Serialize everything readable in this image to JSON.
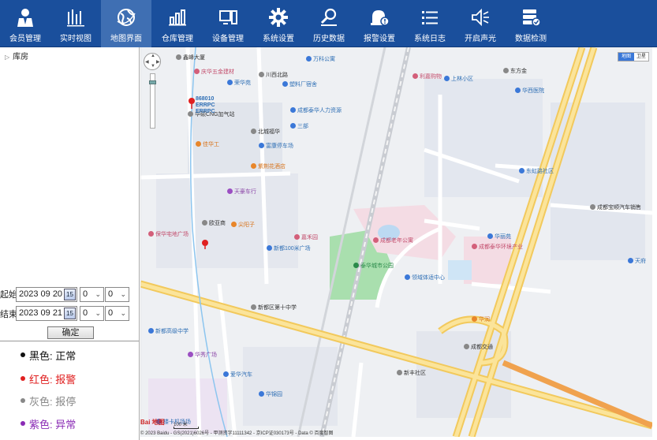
{
  "nav": {
    "items": [
      {
        "label": "会员管理",
        "icon": "member-icon"
      },
      {
        "label": "实时视图",
        "icon": "realtime-chart-icon"
      },
      {
        "label": "地图界面",
        "icon": "map-globe-icon"
      },
      {
        "label": "仓库管理",
        "icon": "warehouse-chart-icon"
      },
      {
        "label": "设备管理",
        "icon": "device-icon"
      },
      {
        "label": "系统设置",
        "icon": "gear-icon"
      },
      {
        "label": "历史数据",
        "icon": "history-search-icon"
      },
      {
        "label": "报警设置",
        "icon": "alarm-icon"
      },
      {
        "label": "系统日志",
        "icon": "log-list-icon"
      },
      {
        "label": "开启声光",
        "icon": "speaker-icon"
      },
      {
        "label": "数据检测",
        "icon": "data-check-icon"
      }
    ],
    "active_index": 2,
    "bg_color": "#1a4f9c"
  },
  "sidebar": {
    "tree_root": "库房",
    "start_label": "起始",
    "end_label": "结束",
    "start_date": "2023 09 20",
    "end_date": "2023 09 21",
    "calendar_icon_text": "15",
    "start_hour": "0",
    "start_minute": "0",
    "end_hour": "0",
    "end_minute": "0",
    "confirm_label": "确定"
  },
  "legend": [
    {
      "text": "黑色: 正常",
      "color": "#111111"
    },
    {
      "text": "红色: 报警",
      "color": "#e02020"
    },
    {
      "text": "灰色: 报停",
      "color": "#888888"
    },
    {
      "text": "紫色: 异常",
      "color": "#8a2bb5"
    }
  ],
  "map": {
    "type_map": "地图",
    "type_satellite": "卫星",
    "scale_text": "100 米",
    "logo_text": "Bai 地图",
    "copyright": "© 2023 Baidu - GS(2021)6026号 - 甲测资字11111342 - 京ICP证030173号 - Data © 百度智图",
    "device_label_1": "868010",
    "device_label_2": "ERRPC",
    "device_label_3": "ERRPC",
    "pois": [
      {
        "name": "鑫峰大厦",
        "cls": "dark"
      },
      {
        "name": "庆华五金建材",
        "cls": "pink"
      },
      {
        "name": "荣华苑",
        "cls": "blue"
      },
      {
        "name": "川西北路",
        "cls": "dark"
      },
      {
        "name": "万科公寓",
        "cls": "blue"
      },
      {
        "name": "塑料厂宿舍",
        "cls": "blue"
      },
      {
        "name": "成都泰华人力资源",
        "cls": "blue"
      },
      {
        "name": "华硕CNG加气站",
        "cls": "dark"
      },
      {
        "name": "北城福华",
        "cls": "dark"
      },
      {
        "name": "三部",
        "cls": "blue"
      },
      {
        "name": "富康停车场",
        "cls": "blue"
      },
      {
        "name": "佳华工",
        "cls": "orange"
      },
      {
        "name": "紫荆花酒店",
        "cls": "orange"
      },
      {
        "name": "天豪车行",
        "cls": "purple"
      },
      {
        "name": "尖阳子",
        "cls": "orange"
      },
      {
        "name": "保华宅地广场",
        "cls": "pink"
      },
      {
        "name": "欧亚商",
        "cls": "dark"
      },
      {
        "name": "新都100米广场",
        "cls": "blue"
      },
      {
        "name": "嘉禾园",
        "cls": "pink"
      },
      {
        "name": "成都老年公寓",
        "cls": "pink"
      },
      {
        "name": "泰华城市公园",
        "cls": "green"
      },
      {
        "name": "领域体适中心",
        "cls": "blue"
      },
      {
        "name": "利嘉购物",
        "cls": "pink"
      },
      {
        "name": "成都泰华环境产业",
        "cls": "pink"
      },
      {
        "name": "华丽苑",
        "cls": "blue"
      },
      {
        "name": "华润",
        "cls": "orange"
      },
      {
        "name": "成都交通",
        "cls": "dark"
      },
      {
        "name": "新都高级中学",
        "cls": "blue"
      },
      {
        "name": "华锦园",
        "cls": "blue"
      },
      {
        "name": "东方金",
        "cls": "dark"
      },
      {
        "name": "上林小区",
        "cls": "blue"
      },
      {
        "name": "东虹路社区",
        "cls": "blue"
      },
      {
        "name": "成都宝顺汽车销售",
        "cls": "dark"
      },
      {
        "name": "楼卡机场场",
        "cls": "blue"
      },
      {
        "name": "爱华汽车",
        "cls": "blue"
      },
      {
        "name": "华秀广场",
        "cls": "purple"
      },
      {
        "name": "新都区第十中学",
        "cls": "dark"
      },
      {
        "name": "华西医院",
        "cls": "blue"
      },
      {
        "name": "新丰社区",
        "cls": "dark"
      },
      {
        "name": "天府",
        "cls": "blue"
      }
    ]
  }
}
